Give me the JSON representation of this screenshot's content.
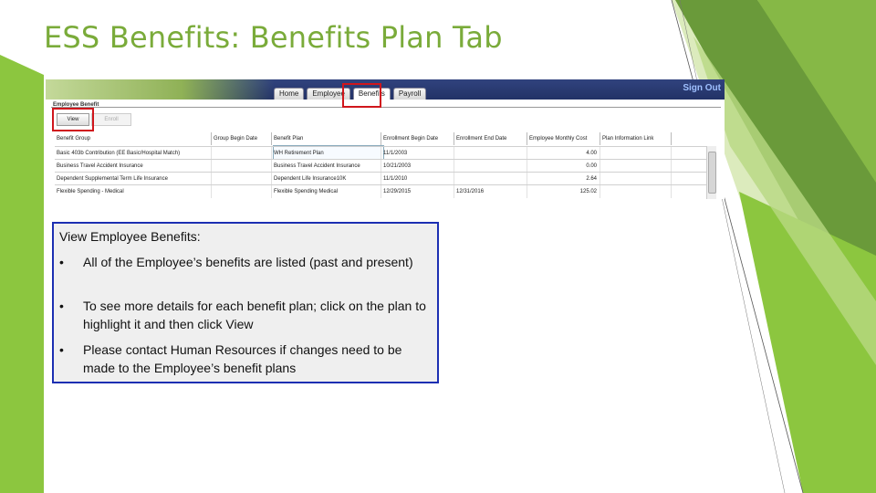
{
  "slide": {
    "title": "ESS Benefits: Benefits Plan Tab",
    "accent_color": "#7aab3a"
  },
  "app": {
    "tabs": [
      "Home",
      "Employee",
      "Benefits",
      "Payroll"
    ],
    "active_tab": "Benefits",
    "sign_out_label": "Sign Out",
    "section_label": "Employee Benefit",
    "buttons": {
      "view": "View",
      "enroll": "Enroll"
    }
  },
  "benefits_table": {
    "columns": [
      "Benefit Group",
      "Group Begin Date",
      "Benefit Plan",
      "Enrollment Begin Date",
      "Enrollment End Date",
      "Employee Monthly Cost",
      "Plan Information Link"
    ],
    "rows": [
      [
        "Basic 403b Contribution (EE Basic/Hospital Match)",
        "",
        "WH Retirement Plan",
        "11/1/2003",
        "",
        "4.00",
        ""
      ],
      [
        "Business Travel Accident Insurance",
        "",
        "Business Travel Accident Insurance",
        "10/21/2003",
        "",
        "0.00",
        ""
      ],
      [
        "Dependent Supplemental Term Life Insurance",
        "",
        "Dependent Life Insurance10K",
        "11/1/2010",
        "",
        "2.64",
        ""
      ],
      [
        "Flexible Spending - Medical",
        "",
        "Flexible Spending Medical",
        "12/29/2015",
        "12/31/2016",
        "125.02",
        ""
      ]
    ]
  },
  "info": {
    "heading": "View Employee Benefits:",
    "bullet_glyph": "•",
    "bullets": [
      "All of the Employee’s benefits are listed (past and present)",
      "To see more details for each benefit plan; click on the plan to highlight it and then click View",
      "Please contact Human Resources if changes need to be made to the Employee’s benefit plans"
    ]
  }
}
